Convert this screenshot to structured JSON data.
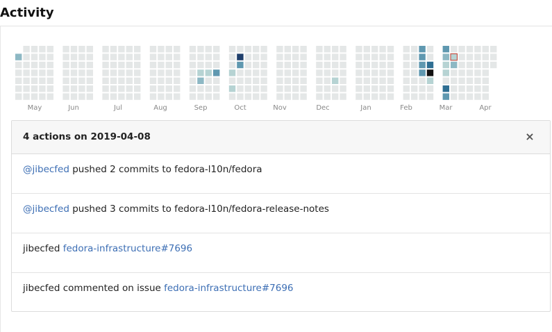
{
  "heading": "Activity",
  "heatmap": {
    "months": [
      "May",
      "Jun",
      "Jul",
      "Aug",
      "Sep",
      "Oct",
      "Nov",
      "Dec",
      "Jan",
      "Feb",
      "Mar",
      "Apr"
    ],
    "colors": {
      "empty": "#e4e7e7",
      "level1": "#b6d3d3",
      "level2": "#8db8c4",
      "level3": "#5f98b0",
      "level4": "#2f6f93",
      "level5": "#1f3f6b",
      "level6": "#111111",
      "selected_border": "#c0392b"
    }
  },
  "panel": {
    "title": "4 actions on 2019-04-08",
    "close_icon": "×",
    "rows": [
      {
        "user": "@jibecfed",
        "text": " pushed 2 commits to fedora-l10n/fedora"
      },
      {
        "user": "@jibecfed",
        "text": " pushed 3 commits to fedora-l10n/fedora-release-notes"
      },
      {
        "prefix": "jibecfed ",
        "link": "fedora-infrastructure#7696"
      },
      {
        "prefix": "jibecfed commented on issue ",
        "link": "fedora-infrastructure#7696"
      }
    ]
  }
}
